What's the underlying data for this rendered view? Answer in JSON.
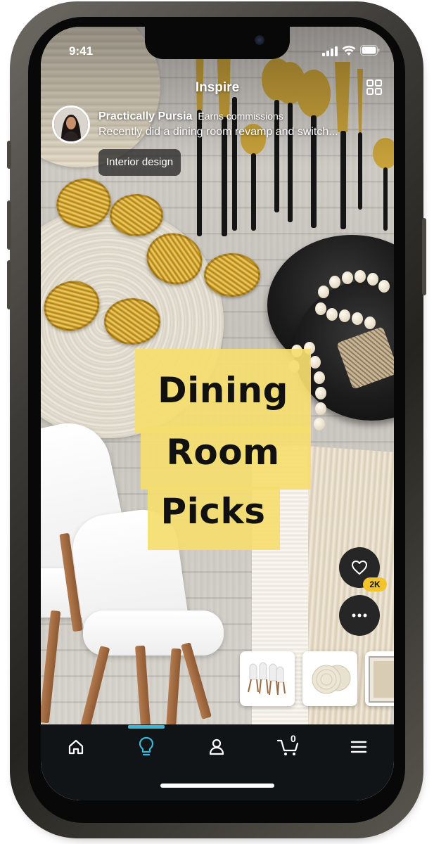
{
  "status_bar": {
    "time": "9:41"
  },
  "header": {
    "title": "Inspire"
  },
  "post": {
    "author": "Practically Pursia",
    "commission_label": "Earns commissions",
    "caption": "Recently did a dining room revamp and switch...",
    "tag": "Interior design",
    "title_lines": [
      "Dining",
      "Room",
      "Picks"
    ]
  },
  "actions": {
    "likes_count": "2K"
  },
  "products": [
    {
      "name": "white-dining-chairs"
    },
    {
      "name": "round-woven-placemats"
    },
    {
      "name": "table-runner"
    }
  ],
  "nav": {
    "cart_count": "0",
    "active_tab": "inspire"
  },
  "colors": {
    "accent": "#3fb6d6",
    "badge": "#f3c32e",
    "title_block": "#f5dd6e"
  },
  "icons": [
    "grid-icon",
    "heart-icon",
    "more-icon",
    "home-icon",
    "lightbulb-icon",
    "person-icon",
    "cart-icon",
    "menu-icon"
  ]
}
